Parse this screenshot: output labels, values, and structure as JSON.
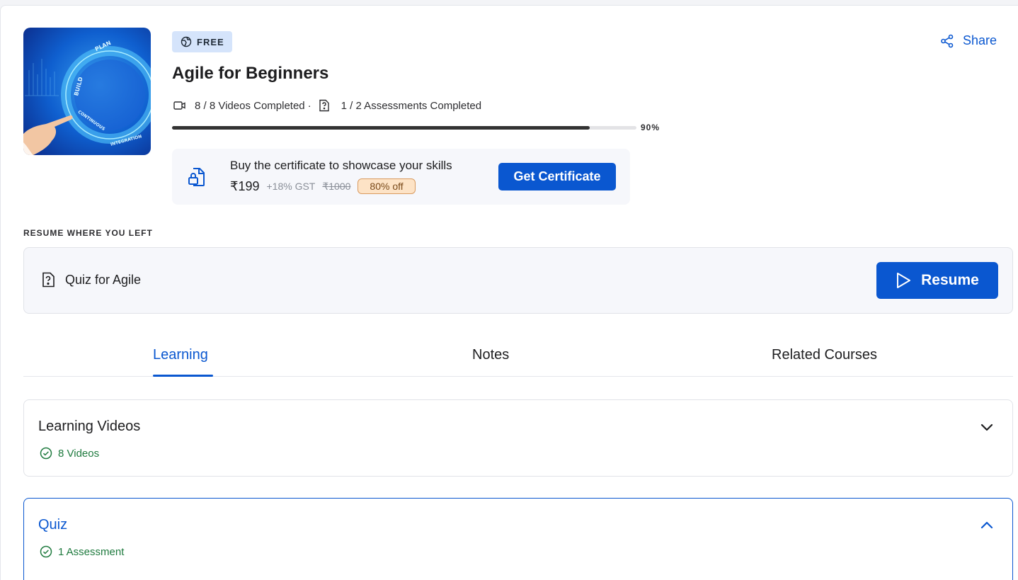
{
  "course": {
    "badge": "FREE",
    "title": "Agile for Beginners",
    "videos_completed": "8 / 8 Videos Completed",
    "separator": "·",
    "assessments_completed": "1 / 2 Assessments Completed",
    "progress_percent": 90,
    "progress_label": "90%",
    "thumbnail": {
      "words": [
        "PLAN",
        "BUILD",
        "CONTINUOUS",
        "INTEGRATION"
      ]
    }
  },
  "share": {
    "label": "Share"
  },
  "certificate": {
    "headline": "Buy the certificate to showcase your skills",
    "price": "₹199",
    "gst": "+18% GST",
    "mrp": "₹1000",
    "discount": "80% off",
    "button_label": "Get Certificate"
  },
  "resume": {
    "section_label": "RESUME WHERE YOU LEFT",
    "item": "Quiz for Agile",
    "button_label": "Resume"
  },
  "tabs": [
    {
      "label": "Learning",
      "active": true
    },
    {
      "label": "Notes",
      "active": false
    },
    {
      "label": "Related Courses",
      "active": false
    }
  ],
  "sections": [
    {
      "title": "Learning Videos",
      "subtitle": "8 Videos",
      "expanded": false
    },
    {
      "title": "Quiz",
      "subtitle": "1 Assessment",
      "expanded": true
    }
  ],
  "colors": {
    "accent": "#0a57d0",
    "success": "#1e7a3e",
    "badge_bg": "#d5e4fb",
    "discount_bg": "#fde3c6"
  },
  "icons": {
    "badge": "globe-icon",
    "video": "video-camera-icon",
    "assessment": "question-document-icon",
    "certificate": "lock-document-icon",
    "share": "share-icon",
    "resume": "play-icon",
    "check": "check-circle-icon",
    "collapse": "chevron-up-icon",
    "expand": "chevron-down-icon"
  }
}
